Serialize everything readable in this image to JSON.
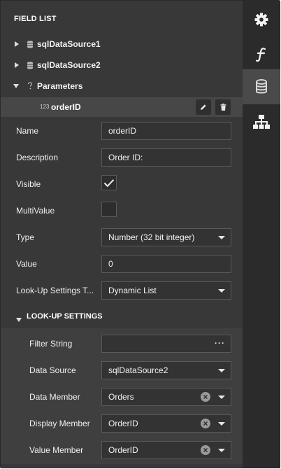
{
  "panel": {
    "title": "FIELD LIST"
  },
  "tree": {
    "items": [
      {
        "label": "sqlDataSource1"
      },
      {
        "label": "sqlDataSource2"
      },
      {
        "label": "Parameters"
      }
    ],
    "parameter": {
      "type_badge": "123",
      "label": "orderID"
    }
  },
  "props": {
    "name": {
      "label": "Name",
      "value": "orderID"
    },
    "description": {
      "label": "Description",
      "value": "Order ID:"
    },
    "visible": {
      "label": "Visible",
      "checked": true
    },
    "multivalue": {
      "label": "MultiValue",
      "checked": false
    },
    "type": {
      "label": "Type",
      "value": "Number (32 bit integer)"
    },
    "value": {
      "label": "Value",
      "value": "0"
    },
    "lookup_type": {
      "label": "Look-Up Settings T...",
      "value": "Dynamic List"
    }
  },
  "lookup": {
    "header": "LOOK-UP SETTINGS",
    "filter_string": {
      "label": "Filter String",
      "value": "",
      "button": "···"
    },
    "data_source": {
      "label": "Data Source",
      "value": "sqlDataSource2"
    },
    "data_member": {
      "label": "Data Member",
      "value": "Orders"
    },
    "display_member": {
      "label": "Display Member",
      "value": "OrderID"
    },
    "value_member": {
      "label": "Value Member",
      "value": "OrderID"
    }
  },
  "sidebar": {
    "tabs": [
      {
        "icon": "gear-icon",
        "active": false
      },
      {
        "icon": "function-icon",
        "active": false
      },
      {
        "icon": "database-icon",
        "active": true
      },
      {
        "icon": "hierarchy-icon",
        "active": false
      }
    ]
  },
  "colors": {
    "panel_bg": "#383838",
    "sidebar_bg": "#2b2b2b",
    "active_tab_bg": "#4a4a4a",
    "field_bg": "#333333"
  }
}
